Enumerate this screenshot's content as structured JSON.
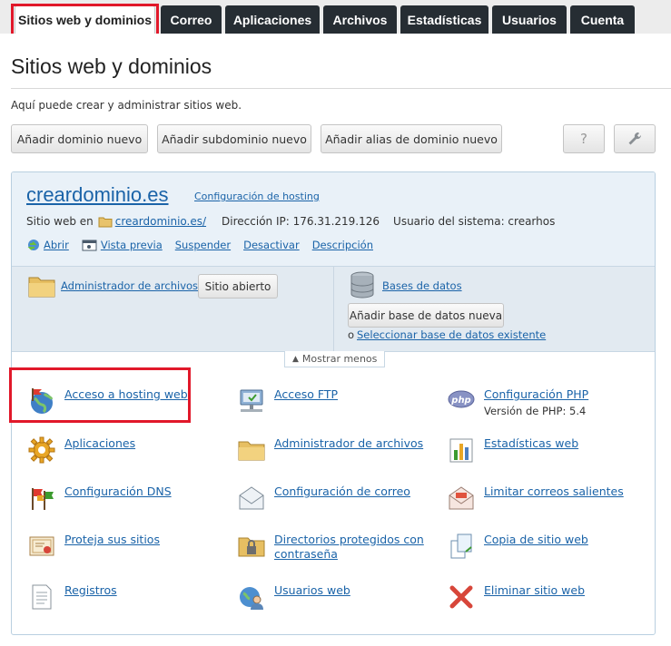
{
  "tabs": [
    "Sitios web y dominios",
    "Correo",
    "Aplicaciones",
    "Archivos",
    "Estadísticas",
    "Usuarios",
    "Cuenta"
  ],
  "page_title": "Sitios web y dominios",
  "intro": "Aquí puede crear y administrar sitios web.",
  "toolbar": {
    "add_domain": "Añadir dominio nuevo",
    "add_subdomain": "Añadir subdominio nuevo",
    "add_alias": "Añadir alias de dominio nuevo",
    "help": "?"
  },
  "domain": {
    "name": "creardominio.es",
    "hosting_config": "Configuración de hosting",
    "site_prefix": "Sitio web en",
    "site_folder": "creardominio.es/",
    "ip_label": "Dirección IP: 176.31.219.126",
    "user_label": "Usuario del sistema: crearhos",
    "actions": [
      "Abrir",
      "Vista previa",
      "Suspender",
      "Desactivar",
      "Descripción"
    ]
  },
  "files": {
    "link": "Administrador de archivos",
    "button": "Sitio abierto"
  },
  "databases": {
    "link": "Bases de datos",
    "button": "Añadir base de datos nueva",
    "bullet": "o",
    "select": "Seleccionar base de datos existente"
  },
  "toggle": "Mostrar menos",
  "tools": [
    {
      "label": "Acceso a hosting web",
      "icon": "globe-icon"
    },
    {
      "label": "Acceso FTP",
      "icon": "ftp-icon"
    },
    {
      "label": "Configuración PHP",
      "icon": "php-icon",
      "sub": "Versión de PHP: 5.4"
    },
    {
      "label": "Aplicaciones",
      "icon": "gear-icon"
    },
    {
      "label": "Administrador de archivos",
      "icon": "folder-icon"
    },
    {
      "label": "Estadísticas web",
      "icon": "bar-chart-icon"
    },
    {
      "label": "Configuración DNS",
      "icon": "flags-icon"
    },
    {
      "label": "Configuración de correo",
      "icon": "envelope-icon"
    },
    {
      "label": "Limitar correos salientes",
      "icon": "mail-limit-icon"
    },
    {
      "label": "Proteja sus sitios",
      "icon": "certificate-icon"
    },
    {
      "label": "Directorios protegidos con contraseña",
      "icon": "locked-folder-icon"
    },
    {
      "label": "Copia de sitio web",
      "icon": "copy-icon"
    },
    {
      "label": "Registros",
      "icon": "log-icon"
    },
    {
      "label": "Usuarios web",
      "icon": "web-users-icon"
    },
    {
      "label": "Eliminar sitio web",
      "icon": "delete-icon"
    }
  ],
  "colors": {
    "link": "#1a63a8",
    "tab_dark": "#262d33",
    "highlight": "#e1182a",
    "panel_head": "#e9f1f8"
  }
}
